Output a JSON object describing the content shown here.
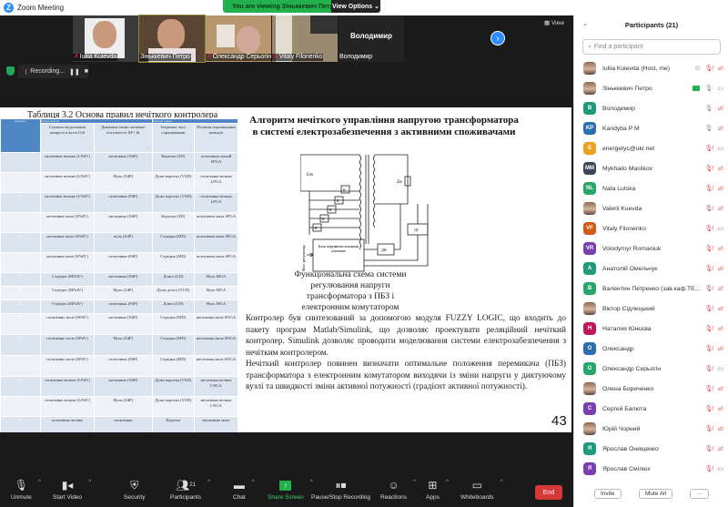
{
  "window": {
    "title": "Zoom Meeting"
  },
  "banner": {
    "text": "You are viewing Зіньккевич Петро's screen",
    "view_options": "View Options ⌄"
  },
  "video_strip": {
    "tiles": [
      {
        "name": "Iuliia Kuievda"
      },
      {
        "name": "Зіньккевич Петро"
      },
      {
        "name": "Олександр Серьогін"
      },
      {
        "name": "Vitaly Filonenko"
      },
      {
        "name": "Володимир",
        "big": "Володимир"
      }
    ],
    "view_label": "View"
  },
  "recording": {
    "label": "Recording..."
  },
  "slide": {
    "table_title": "Таблиця 3.2 Основа правил нечіткого контролера",
    "sub_in": "Вхідні змінні",
    "sub_out": "Вихідні змінні",
    "headers": [
      "Правило",
      "Сигнали відхилення напруги в вузлі Udt",
      "Динаміка зміни активної потужності ΔP / Δt",
      "Затримка часу спрацювання",
      "Позиція перемикання виводів"
    ],
    "rows": [
      [
        "1",
        "негативне велике (LNdV)",
        "негативна (NdP)",
        "Коротка (SD)",
        "позитивна малий SPGA"
      ],
      [
        "2",
        "негативне велике (LNdV)",
        "Нуль (ZdP)",
        "Дуже коротко (VSD)",
        "позитивна велика LPGA"
      ],
      [
        "3",
        "негативне велике (LNdV)",
        "позитивна (PdP)",
        "Дуже коротко (VSD)",
        "позитивна велика LPGA"
      ],
      [
        "4",
        "негативне мале (SNdV)",
        "негативна (NdP)",
        "Коротка (SD)",
        "позитивна мала SPGA"
      ],
      [
        "5",
        "негативне мале (SNdV)",
        "нуль (ZdP)",
        "Середня (MD)",
        "позитивна мала SPGA"
      ],
      [
        "6",
        "негативне мале (SNdV)",
        "позитивна (PdP)",
        "Середня (MD)",
        "позитивна мала SPGA"
      ],
      [
        "7",
        "Середнє (MNdV)",
        "негативна (NdP)",
        "Довга (LD)",
        "Нуль MGA"
      ],
      [
        "8",
        "Середнє (MNdV)",
        "Нуль (ZdP)",
        "Дуже довга (VLD)",
        "Нуль MGA"
      ],
      [
        "9",
        "Середнє (MNdV)",
        "позитивна (PdP)",
        "Довга (LD)",
        "Нуль MGA"
      ],
      [
        "10",
        "позитивне мале (SPdV)",
        "негативна (NdP)",
        "Середня (MD)",
        "негативна мала SNGA"
      ],
      [
        "11",
        "позитивне мале (SPdV)",
        "Нуль (ZdP)",
        "Середня (MD)",
        "негативна мала SNGA"
      ],
      [
        "12",
        "позитивне мале (SPdV)",
        "позитивна (PdP)",
        "Середня (MD)",
        "негативна мала SNGA"
      ],
      [
        "13",
        "позитивне велике (LPdV)",
        "негативна (NdP)",
        "Дуже коротка (VSD)",
        "негативна велика LNGA"
      ],
      [
        "14",
        "позитивне велике (LPdV)",
        "Нуль (ZdP)",
        "Дуже коротко (VSD)",
        "негативна велика LNGA"
      ],
      [
        "15",
        "позитивне велике",
        "позитивна",
        "Коротка",
        "негативна мала"
      ]
    ],
    "heading": "Алгоритм нечіткого управління  напругою трансформатора в системі електрозабезпечення з активними споживачами",
    "diagram": {
      "u_label": "Uм",
      "z_label": "Zн",
      "key_label": "К",
      "block_label": "Блок керування силовими ключами",
      "dn_label": "ДН",
      "ds_label": "ДС",
      "side_label": "Фазі регулятор"
    },
    "caption": [
      "Функціональна схема системи",
      "регулювання напруги",
      "трансформатора з ПБЗ і",
      "електронним комутатором"
    ],
    "paragraph1": "Контролер був синтезований за допомогою модуля FUZZY LOGIC, що входить до пакету програм Matlab/Simulink, що дозволяє проектувати реляційний нечіткий контролер. Simulink дозволяє проводити моделювання системи електрозабезпечення з нечітким контролером.",
    "paragraph2": "Нечіткий контролер повинен визначати оптимальне положення перемикача (ПБЗ) трансформатора з електронним комутатором виходячи із зміни напруги у диктуючому  вузлі та швидкості зміни активної потужності (градієнт активної потужності).",
    "page_number": "43"
  },
  "toolbar": {
    "unmute": "Unmute",
    "start_video": "Start Video",
    "security": "Security",
    "participants": "Participants",
    "participants_count": "21",
    "chat": "Chat",
    "share_screen": "Share Screen",
    "pause_stop": "Pause/Stop Recording",
    "reactions": "Reactions",
    "apps": "Apps",
    "whiteboards": "Whiteboards",
    "end": "End"
  },
  "participants_panel": {
    "title": "Participants (21)",
    "search_placeholder": "Find a participant",
    "invite": "Invite",
    "mute_all": "Mute All",
    "more": "···",
    "list": [
      {
        "name": "Iuliia Kuievda (Host, me)",
        "initials": "",
        "color": "",
        "mic": "muted",
        "video": "off",
        "extra": "rec"
      },
      {
        "name": "Зіньккевич Петро",
        "initials": "",
        "color": "",
        "mic": "on",
        "video": "on",
        "extra": "share"
      },
      {
        "name": "Володимир",
        "initials": "В",
        "color": "#1f9a7a",
        "mic": "on",
        "video": "off"
      },
      {
        "name": "Kandyba P M",
        "initials": "KP",
        "color": "#2c6fb0",
        "mic": "on",
        "video": "off"
      },
      {
        "name": "energetyc@ukr.net",
        "initials": "E",
        "color": "#f0a020",
        "mic": "muted",
        "video": "on"
      },
      {
        "name": "Mykhailo Maslikov",
        "initials": "MM",
        "color": "#3a4756",
        "mic": "muted",
        "video": "off"
      },
      {
        "name": "Nata Lutska",
        "initials": "NL",
        "color": "#27a86a",
        "mic": "muted",
        "video": "off"
      },
      {
        "name": "Valerii Kuevda",
        "initials": "",
        "color": "",
        "mic": "muted",
        "video": "off"
      },
      {
        "name": "Vitaly Filonenko",
        "initials": "VF",
        "color": "#d35a16",
        "mic": "muted",
        "video": "on"
      },
      {
        "name": "Volodymyr Romaniuk",
        "initials": "VR",
        "color": "#7b3fb0",
        "mic": "muted",
        "video": "off"
      },
      {
        "name": "Анатолій Омельчук",
        "initials": "А",
        "color": "#1f9a7a",
        "mic": "muted",
        "video": "off"
      },
      {
        "name": "Валентин Петренко (зав.каф.ТЕ...",
        "initials": "В",
        "color": "#27a86a",
        "mic": "muted",
        "video": "off"
      },
      {
        "name": "Віктор Сідлецький",
        "initials": "",
        "color": "",
        "mic": "muted",
        "video": "off"
      },
      {
        "name": "Наталия Юнєєва",
        "initials": "Н",
        "color": "#c0185a",
        "mic": "muted",
        "video": "off"
      },
      {
        "name": "Олександр",
        "initials": "О",
        "color": "#2c6fb0",
        "mic": "muted",
        "video": "off"
      },
      {
        "name": "Олександр Серьогін",
        "initials": "О",
        "color": "#27a86a",
        "mic": "muted",
        "video": "on"
      },
      {
        "name": "Олена Бориченко",
        "initials": "",
        "color": "",
        "mic": "muted",
        "video": "off"
      },
      {
        "name": "Сергей Балюта",
        "initials": "С",
        "color": "#7b3fb0",
        "mic": "muted",
        "video": "off"
      },
      {
        "name": "Юрій Чорний",
        "initials": "",
        "color": "",
        "mic": "muted",
        "video": "off"
      },
      {
        "name": "Ярослав Онищенко",
        "initials": "Я",
        "color": "#1f9a7a",
        "mic": "muted",
        "video": "off"
      },
      {
        "name": "Ярослав Смілюх",
        "initials": "Я",
        "color": "#7b3fb0",
        "mic": "muted",
        "video": "on"
      }
    ]
  }
}
